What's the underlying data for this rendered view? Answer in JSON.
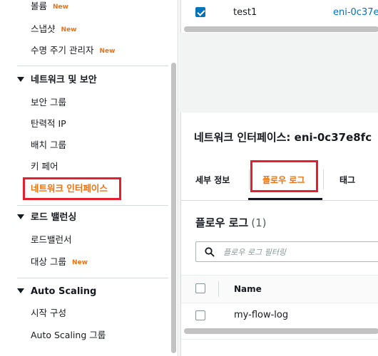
{
  "sidebar": {
    "items_top": [
      {
        "label": "볼륨",
        "badge": "New"
      },
      {
        "label": "스냅샷",
        "badge": "New"
      },
      {
        "label": "수명 주기 관리자",
        "badge": "New"
      }
    ],
    "network_section": {
      "title": "네트워크 및 보안",
      "items": [
        {
          "label": "보안 그룹"
        },
        {
          "label": "탄력적 IP"
        },
        {
          "label": "배치 그룹"
        },
        {
          "label": "키 페어"
        },
        {
          "label": "네트워크 인터페이스",
          "active": true
        }
      ]
    },
    "lb_section": {
      "title": "로드 밸런싱",
      "items": [
        {
          "label": "로드밸런서"
        },
        {
          "label": "대상 그룹",
          "badge": "New"
        }
      ]
    },
    "as_section": {
      "title": "Auto Scaling",
      "items": [
        {
          "label": "시작 구성"
        },
        {
          "label": "Auto Scaling 그룹"
        }
      ]
    }
  },
  "top_table": {
    "row": {
      "checked": true,
      "name": "test1",
      "id": "eni-0c37e8"
    }
  },
  "detail": {
    "title": "네트워크 인터페이스: eni-0c37e8fc",
    "tabs": [
      {
        "label": "세부 정보"
      },
      {
        "label": "플로우 로그",
        "active": true
      },
      {
        "label": "태그"
      }
    ],
    "flow_logs": {
      "title": "플로우 로그",
      "count": "(1)",
      "filter_placeholder": "플로우 로그 필터링",
      "columns": [
        "Name"
      ],
      "rows": [
        {
          "name": "my-flow-log"
        }
      ]
    }
  },
  "colors": {
    "accent": "#ec7211",
    "link": "#0073bb",
    "highlight": "#e5202e"
  }
}
